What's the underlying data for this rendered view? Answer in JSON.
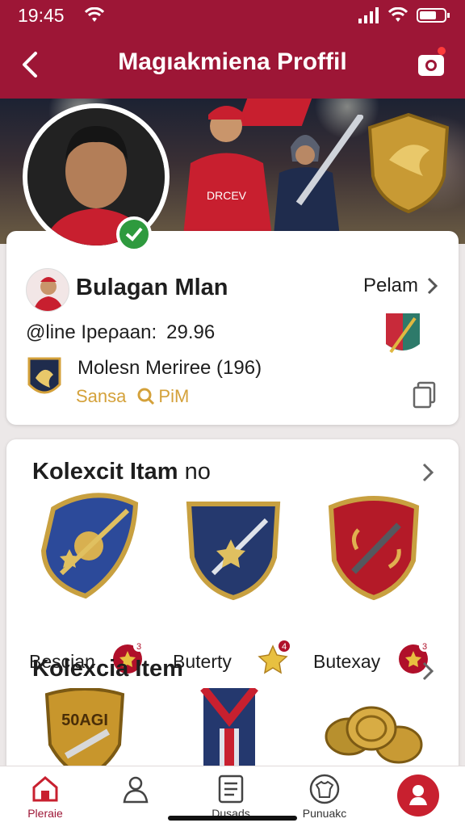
{
  "status_bar": {
    "time": "19:45"
  },
  "header": {
    "title": "Magıakmiena Proffil"
  },
  "profile": {
    "name": "Bulagan Mlan",
    "action_label": "Pelam",
    "stat_label": "@line Ipeρaan:",
    "stat_value": "29.96",
    "team": "Molesn Meriree (196)",
    "tag1": "Sansa",
    "tag2": "Pi⁠M"
  },
  "sections": [
    {
      "title": "Kolexcit Itam",
      "title_suffix": "no",
      "items": [
        {
          "label": "Bescian",
          "badge": "3",
          "icon": "blue-spear-shield-icon"
        },
        {
          "label": "Buterty",
          "badge": "4",
          "icon": "blue-star-shield-icon"
        },
        {
          "label": "Butexay",
          "badge": "3",
          "icon": "red-sword-shield-icon"
        }
      ]
    },
    {
      "title": "Kolexcia Item",
      "title_suffix": "",
      "items": [
        {
          "label": "",
          "crest_text": "50AGI",
          "icon": "gold-crest-icon"
        },
        {
          "label": "",
          "icon": "striped-banner-icon"
        },
        {
          "label": "",
          "icon": "gold-coins-icon"
        }
      ]
    }
  ],
  "bottom_nav": [
    {
      "label": "Pleraie",
      "icon": "home-icon",
      "active": true
    },
    {
      "label": "",
      "icon": "person-icon"
    },
    {
      "label": "Dusads",
      "icon": "list-icon"
    },
    {
      "label": "Punuakc",
      "icon": "shirt-icon"
    },
    {
      "label": "",
      "icon": "profile-icon"
    }
  ],
  "colors": {
    "brand": "#9d1636",
    "gold": "#d4a13a",
    "active_red": "#c8202f"
  }
}
